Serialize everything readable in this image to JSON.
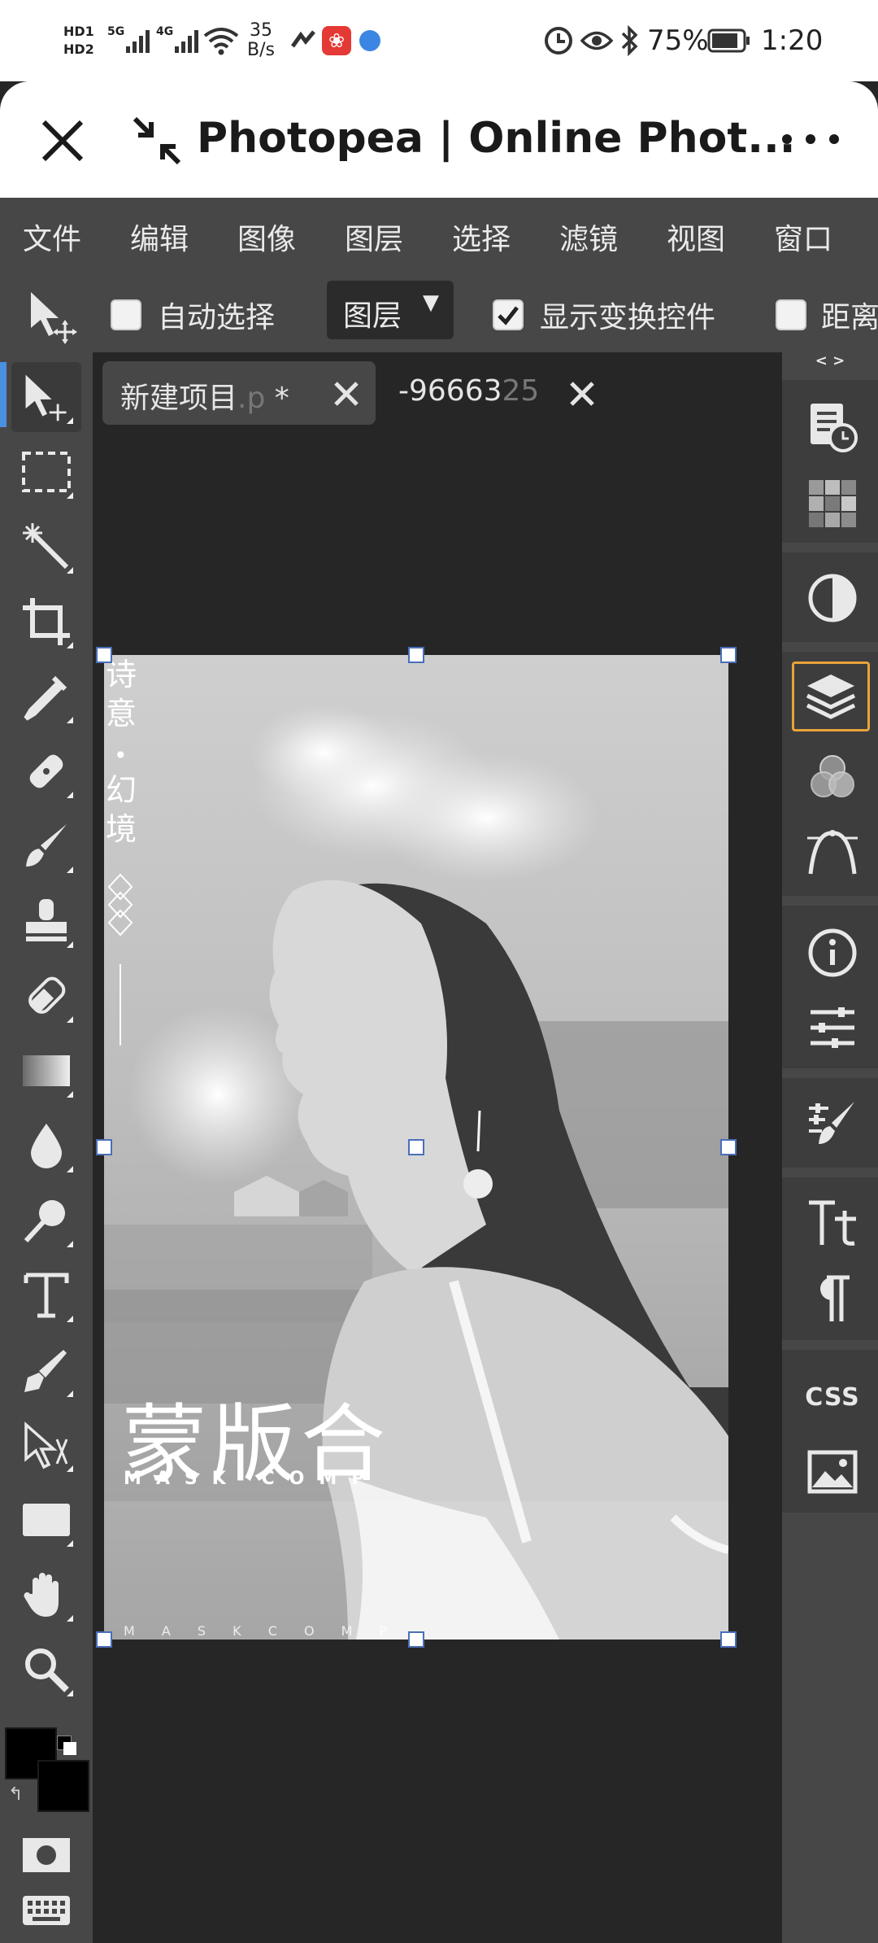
{
  "status_bar": {
    "hd1": "HD1",
    "hd2": "HD2",
    "net1": "5G",
    "net2": "4G",
    "speed_value": "35",
    "speed_unit": "B/s",
    "battery": "75%",
    "time": "1:20"
  },
  "browser": {
    "title": "Photopea | Online Phot..."
  },
  "menu": [
    "文件",
    "编辑",
    "图像",
    "图层",
    "选择",
    "滤镜",
    "视图",
    "窗口"
  ],
  "options_bar": {
    "auto_select_label": "自动选择",
    "layer_dropdown": "图层",
    "show_transform_label": "显示变换控件",
    "distance_label": "距离"
  },
  "tabs": [
    {
      "label": "新建项目",
      "faded_ext": ".p",
      "suffix": " *"
    },
    {
      "label": "-96663",
      "faded": "25"
    }
  ],
  "panel_toggle": "< >",
  "canvas": {
    "vertical_text_1": [
      "诗",
      "意"
    ],
    "bullet": "•",
    "vertical_text_2": [
      "幻",
      "境"
    ],
    "main_title": "蒙版合",
    "subtitle": "MASK COMP",
    "bottom_text": "M A S K   C O M P"
  },
  "right_panel": {
    "css_label": "CSS"
  },
  "colors": {
    "accent_blue": "#4a90e2",
    "active_orange": "#e8a33a",
    "toolbar_bg": "#474747",
    "workspace_bg": "#262626"
  }
}
